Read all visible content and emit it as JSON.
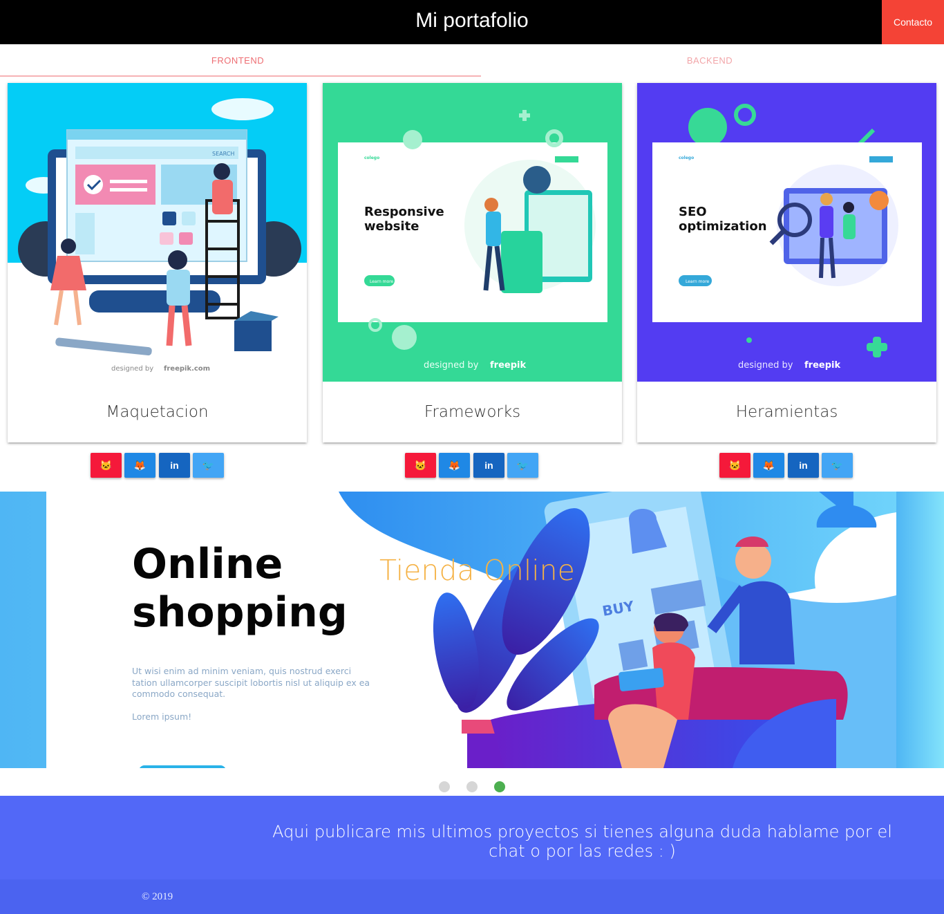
{
  "header": {
    "title": "Mi portafolio",
    "contact_label": "Contacto"
  },
  "tabs": [
    {
      "label": "FRONTEND",
      "active": true
    },
    {
      "label": "BACKEND",
      "active": false
    }
  ],
  "cards": [
    {
      "title": "Maquetacion",
      "image_text": [
        "SEARCH",
        "designed by",
        "freepik.com"
      ],
      "image_color": "#04cdf6"
    },
    {
      "title": "Frameworks",
      "image_text": [
        "Responsive",
        "website",
        "Learn more",
        "colego",
        "designed by",
        "freepik"
      ],
      "image_color": "#34d996"
    },
    {
      "title": "Heramientas",
      "image_text": [
        "SEO",
        "optimization",
        "Learn more",
        "colego",
        "designed by",
        "freepik"
      ],
      "image_color": "#533cf2"
    }
  ],
  "social_buttons": [
    "github-icon",
    "gitlab-icon",
    "linkedin-icon",
    "twitter-icon"
  ],
  "social_glyphs": {
    "gh": "🐱",
    "gl": "🦊",
    "li": "in",
    "tw": "🐦"
  },
  "banner": {
    "headline_line1": "Online",
    "headline_line2": "shopping",
    "lead": "Ut wisi enim ad minim veniam, quis nostrud exerci tation ullamcorper suscipit lobortis nisl ut aliquip ex ea commodo consequat.",
    "lorem": "Lorem ipsum!",
    "caption": "Tienda Online",
    "buy_label": "BUY",
    "slide_count": 3,
    "active_slide": 3
  },
  "info_text": "Aqui publicare mis ultimos proyectos si tienes alguna duda hablame por el chat o por las redes : )",
  "footer": {
    "copyright": "© 2019"
  },
  "colors": {
    "accent": "#f44336",
    "tab": "#ee6e73",
    "indigo": "#5268f7",
    "active_dot": "#4caf50"
  }
}
